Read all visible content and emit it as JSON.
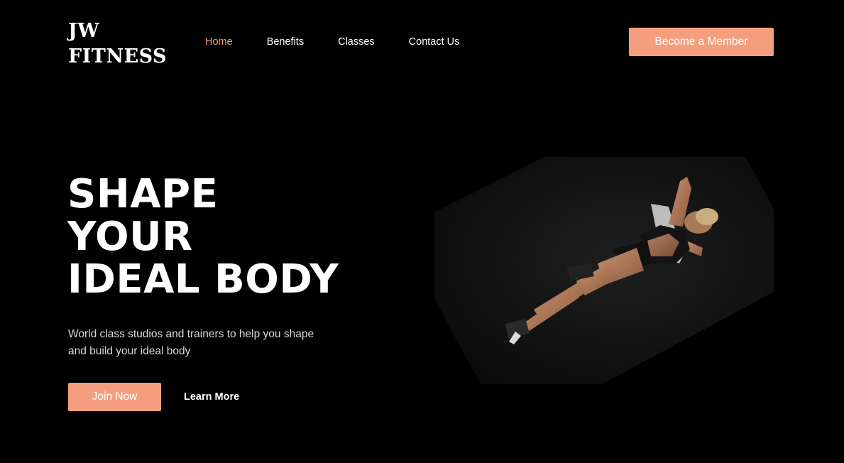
{
  "header": {
    "logo_line1": "JW",
    "logo_line2": "FITNESS",
    "nav": [
      {
        "label": "Home",
        "active": true
      },
      {
        "label": "Benefits",
        "active": false
      },
      {
        "label": "Classes",
        "active": false
      },
      {
        "label": "Contact Us",
        "active": false
      }
    ],
    "cta_label": "Become a Member"
  },
  "hero": {
    "title_line1": "SHAPE",
    "title_line2": "YOUR",
    "title_line3": "IDEAL BODY",
    "subtitle": "World class studios and trainers to help you shape and build your ideal body",
    "primary_button": "Join Now",
    "secondary_link": "Learn More",
    "image_icon": "woman-doing-crunches-photo"
  },
  "colors": {
    "accent": "#f59e7e",
    "background": "#000000",
    "text": "#ffffff"
  }
}
